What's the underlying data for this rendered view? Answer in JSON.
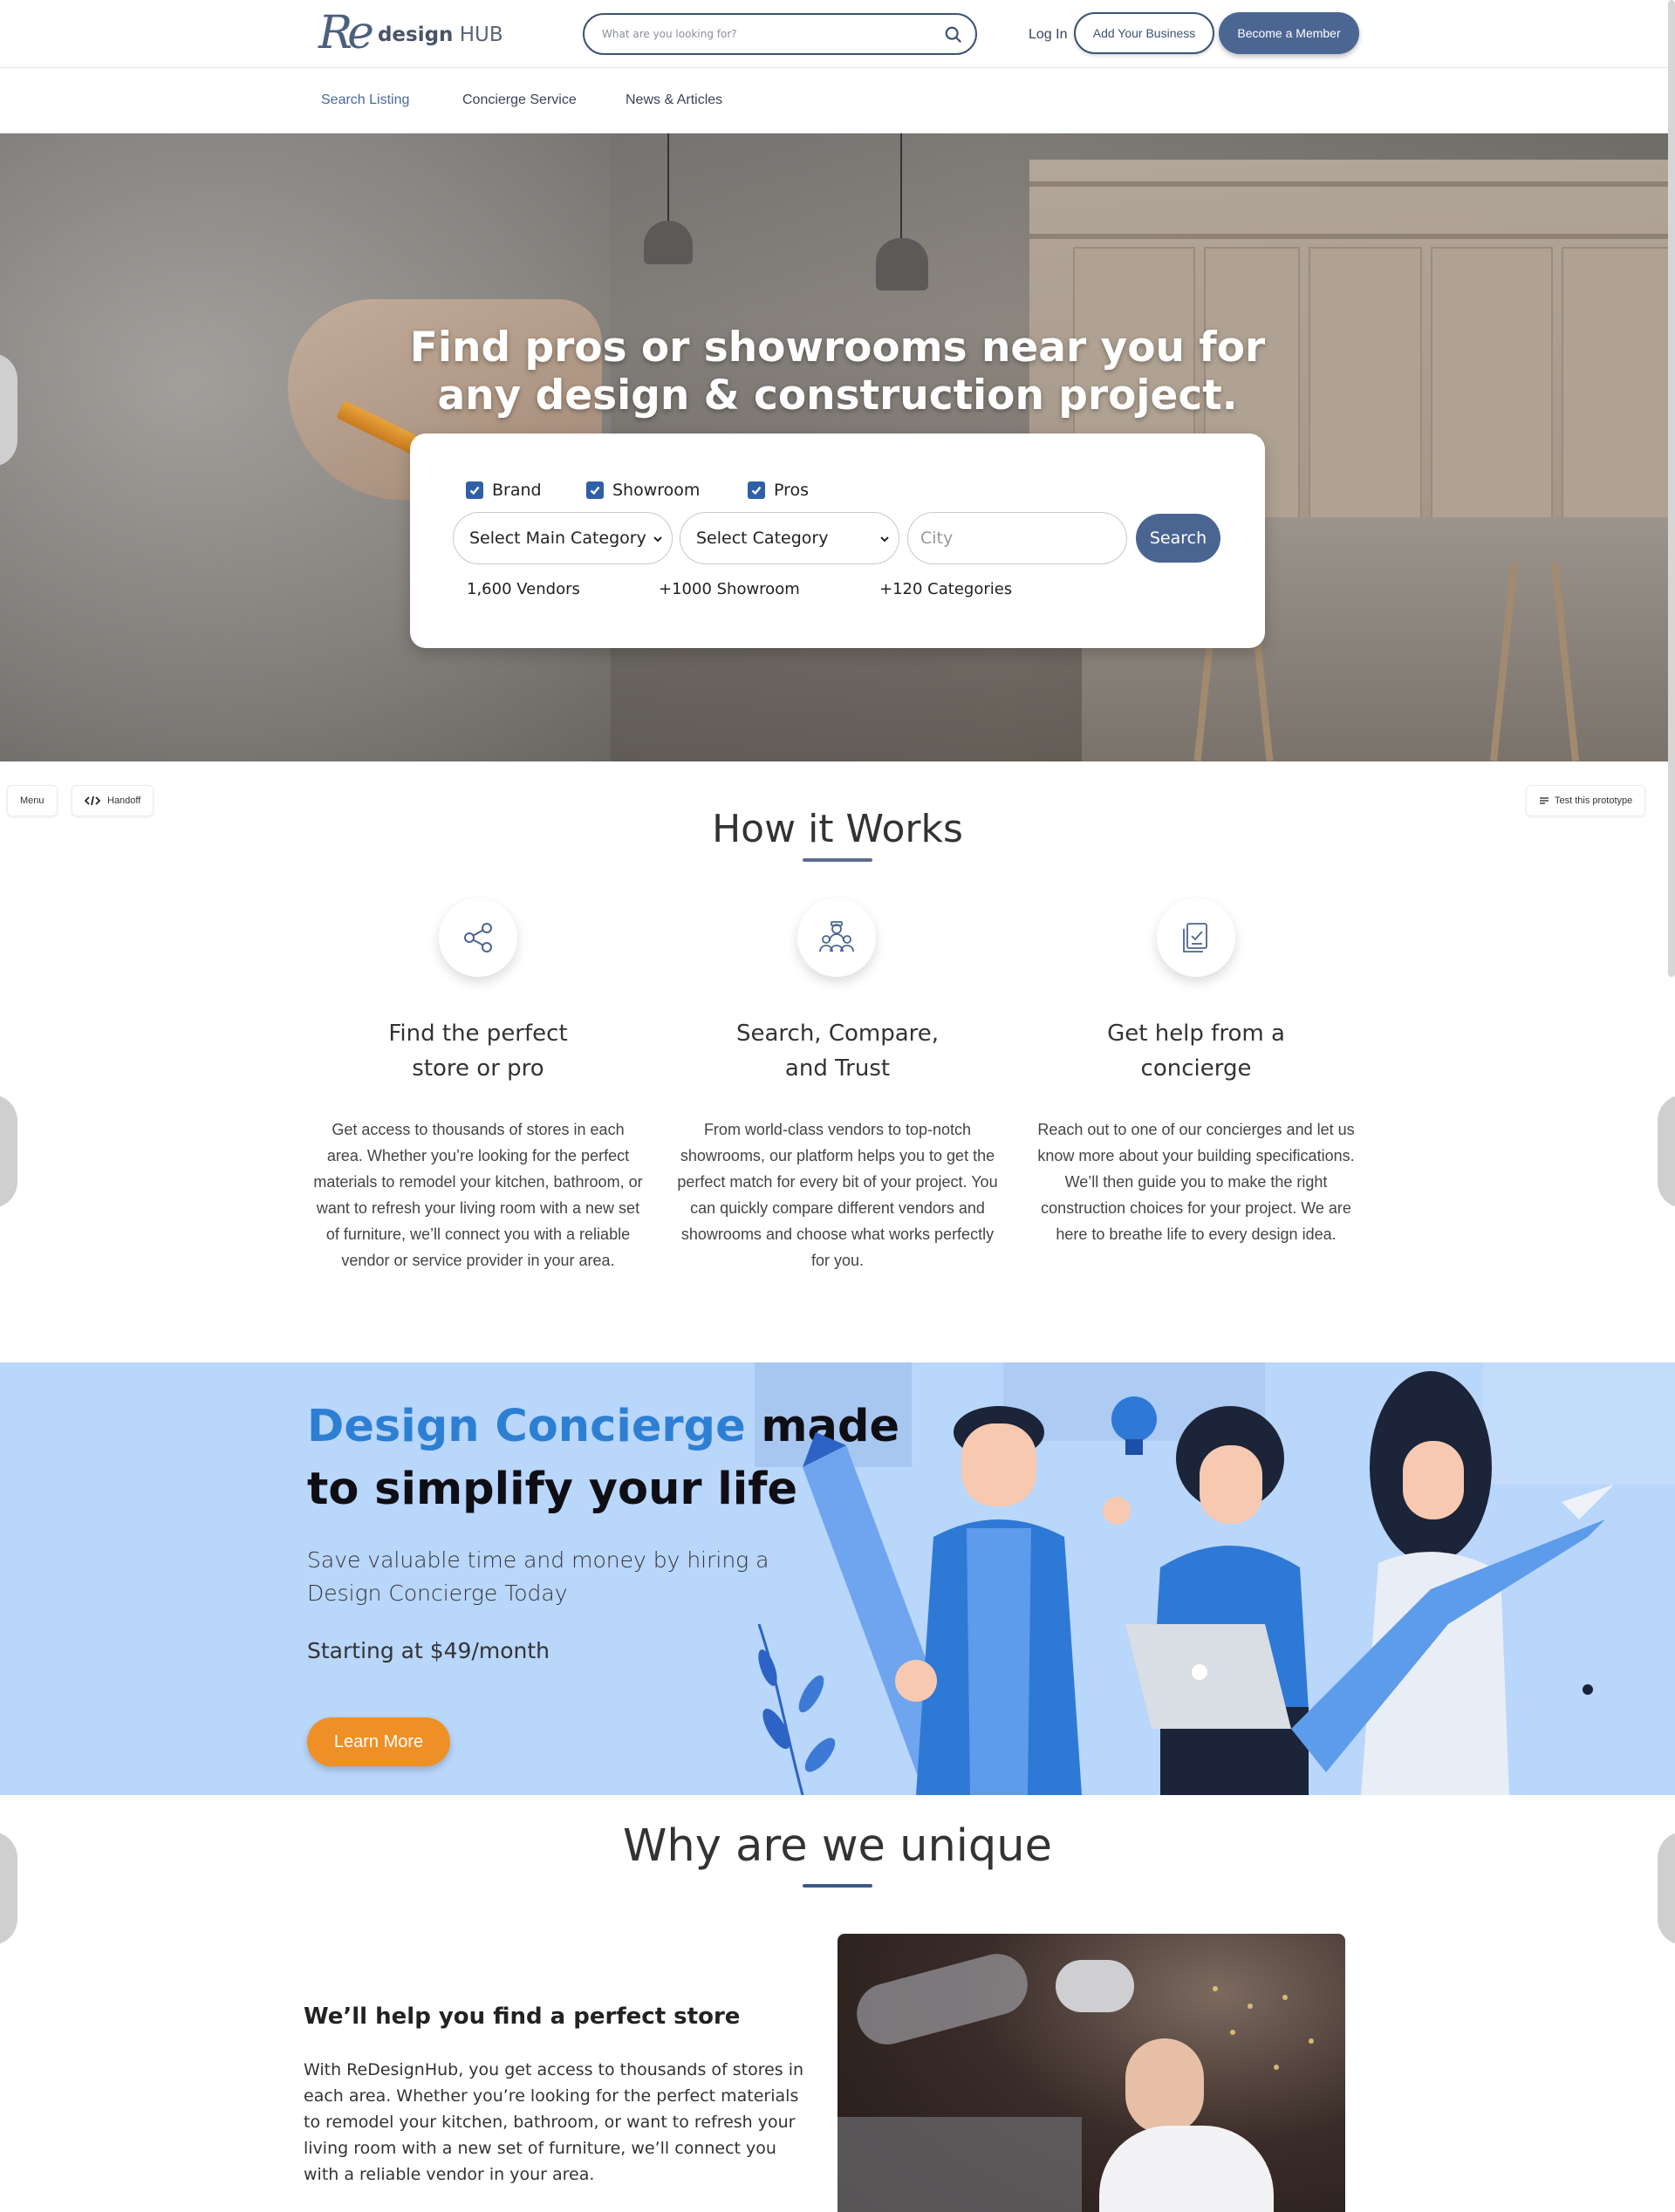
{
  "header": {
    "logo_mark": "Re",
    "logo_word": "design",
    "logo_hub": "HUB",
    "search_placeholder": "What are you looking for?",
    "login": "Log In",
    "add_business": "Add Your Business",
    "become_member": "Become a Member"
  },
  "nav": {
    "items": [
      {
        "label": "Search Listing"
      },
      {
        "label": "Concierge Service"
      },
      {
        "label": "News & Articles"
      }
    ]
  },
  "hero": {
    "title_line1": "Find pros or showrooms near you for",
    "title_line2": "any design & construction project.",
    "checks": [
      {
        "label": "Brand",
        "checked": true
      },
      {
        "label": "Showroom",
        "checked": true
      },
      {
        "label": "Pros",
        "checked": true
      }
    ],
    "main_category": "Select Main Category",
    "category": "Select Category",
    "city_placeholder": "City",
    "search_button": "Search",
    "stats": [
      "1,600 Vendors",
      "+1000 Showroom",
      "+120 Categories"
    ]
  },
  "prototype": {
    "menu": "Menu",
    "handoff": "Handoff",
    "test": "Test this prototype"
  },
  "how": {
    "title": "How it Works",
    "steps": [
      {
        "icon": "share-icon",
        "title_1": "Find the perfect",
        "title_2": "store or pro",
        "text": "Get access to thousands of stores in each area. Whether you’re looking for the perfect materials to remodel your kitchen, bathroom, or want to refresh your living room with a new set of furniture, we’ll connect you with a reliable vendor or service provider in your area."
      },
      {
        "icon": "team-icon",
        "title_1": "Search, Compare,",
        "title_2": "and Trust",
        "text": "From world-class vendors to top-notch showrooms, our platform helps you to get the perfect match for every bit of your project. You can quickly compare different vendors and showrooms and choose what works perfectly for you."
      },
      {
        "icon": "documents-icon",
        "title_1": "Get help from a",
        "title_2": "concierge",
        "text": "Reach out to one of our concierges and let us know more about your building specifications. We’ll then guide you to make the right construction choices for your project. We are here to breathe life to every design idea."
      }
    ]
  },
  "banner": {
    "title_blue": "Design Concierge",
    "title_rest": " made",
    "title_line2": "to simplify your life",
    "subtitle": "Save valuable time and money by hiring a Design Concierge Today",
    "price": "Starting at $49/month",
    "learn_more": "Learn More"
  },
  "unique": {
    "title": "Why are we unique",
    "heading": "We’ll help you find a perfect store",
    "text": "With ReDesignHub, you get access to thousands of stores in each area. Whether you’re looking for the perfect materials to remodel your kitchen, bathroom, or want to refresh your living room with a new set of furniture, we’ll connect you with a reliable vendor in your area."
  },
  "colors": {
    "navy": "#3e5273",
    "button_blue": "#4c6694",
    "banner_bg": "#b9d6fb",
    "accent_blue": "#2d7fd3",
    "orange": "#ee9025"
  }
}
